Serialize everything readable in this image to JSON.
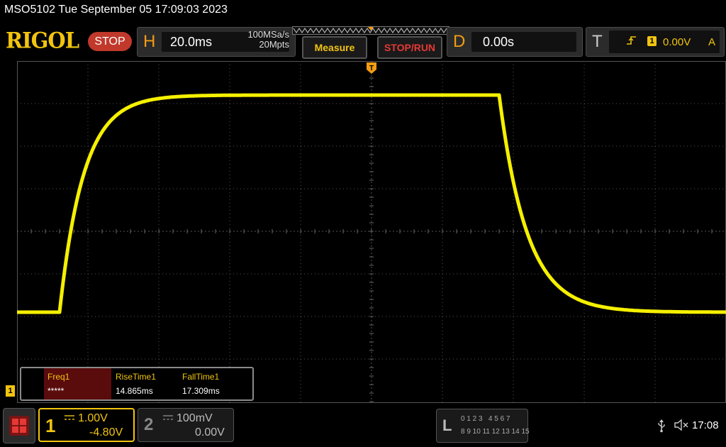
{
  "header": {
    "model_datetime": "MSO5102  Tue September 05 17:09:03 2023"
  },
  "brand": {
    "logo_text": "RIGOL",
    "run_state": "STOP"
  },
  "horizontal": {
    "letter": "H",
    "timebase": "20.0ms",
    "sample_rate": "100MSa/s",
    "memory_depth": "20Mpts"
  },
  "buttons": {
    "measure": "Measure",
    "stop_run": "STOP/RUN"
  },
  "delay": {
    "letter": "D",
    "value": "0.00s"
  },
  "trigger": {
    "letter": "T",
    "source_channel": "1",
    "level": "0.00V",
    "mode": "A",
    "position_marker": "T",
    "edge_icon": "rising-edge-icon"
  },
  "measurements": {
    "freq_label": "Freq1",
    "freq_value": "*****",
    "rise_label": "RiseTime1",
    "rise_value": "14.865ms",
    "fall_label": "FallTime1",
    "fall_value": "17.309ms"
  },
  "ch1_ground_marker": "1",
  "channel1": {
    "number": "1",
    "scale": "1.00V",
    "offset": "-4.80V",
    "coupling": "DC",
    "color": "#f1c40f"
  },
  "channel2": {
    "number": "2",
    "scale": "100mV",
    "offset": "0.00V",
    "coupling": "DC"
  },
  "logic": {
    "letter": "L",
    "row1": "0 1 2 3   4 5 6 7",
    "row2": "8 9 10 11 12 13 14 15"
  },
  "status": {
    "clock": "17:08",
    "usb_icon": "usb-icon",
    "speaker_icon": "speaker-muted-icon"
  },
  "waveform": {
    "channel": "1",
    "color": "#f5f000",
    "low_level_div": -1.9,
    "high_level_div": 3.2,
    "rise_start_div": -4.4,
    "fall_start_div": 1.8,
    "rise_time_ms": 14.865,
    "fall_time_ms": 17.309,
    "time_per_div_ms": 20,
    "volts_per_div": 1.0
  }
}
